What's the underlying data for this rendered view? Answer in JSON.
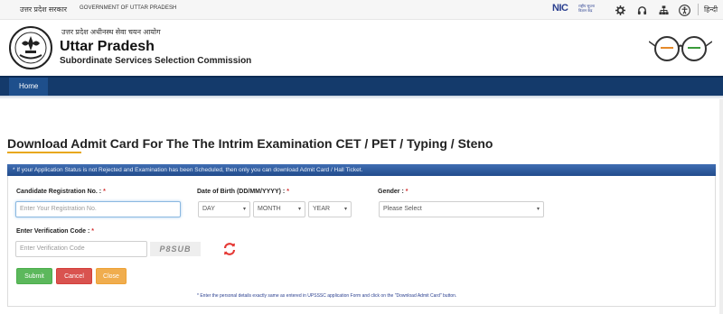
{
  "topbar": {
    "gov_hindi": "उत्तर प्रदेश सरकार",
    "gov_english": "GOVERNMENT OF UTTAR PRADESH",
    "nic": "NIC",
    "nic_sub": "राष्ट्रीय सूचना विज्ञान केंद्र",
    "lang": "हिन्दी",
    "icons": [
      "gear-icon",
      "headphones-icon",
      "sitemap-icon",
      "accessibility-icon"
    ]
  },
  "header": {
    "hindi_line": "उत्तर प्रदेश अधीनस्थ सेवा चयन आयोग",
    "title": "Uttar Pradesh",
    "subtitle": "Subordinate Services Selection Commission"
  },
  "nav": {
    "home": "Home"
  },
  "page": {
    "title": "Download Admit Card For The The Intrim Examination CET / PET / Typing / Steno",
    "notice": "* If your Application Status is not Rejected and Examination has been Scheduled, then only you can download Admit Card / Hall Ticket."
  },
  "form": {
    "reg_label": "Candidate Registration No. :",
    "reg_placeholder": "Enter Your Registration No.",
    "dob_label": "Date of Birth (DD/MM/YYYY) :",
    "day": "DAY",
    "month": "MONTH",
    "year": "YEAR",
    "gender_label": "Gender :",
    "gender_value": "Please Select",
    "verify_label": "Enter Verification Code :",
    "verify_placeholder": "Enter Verification Code",
    "captcha": "P8SUB",
    "star": "*"
  },
  "buttons": {
    "submit": "Submit",
    "cancel": "Cancel",
    "close": "Close"
  },
  "footnote": "* Enter the personal details exactly same as entered in UPSSSC application Form and click on the \"Download Admit Card\" button.",
  "colors": {
    "nav": "#143a6b",
    "notice": "#2f5c9e",
    "submit": "#5cb85c",
    "cancel": "#d9534f",
    "close": "#f0ad4e",
    "required": "#d32f2f"
  }
}
